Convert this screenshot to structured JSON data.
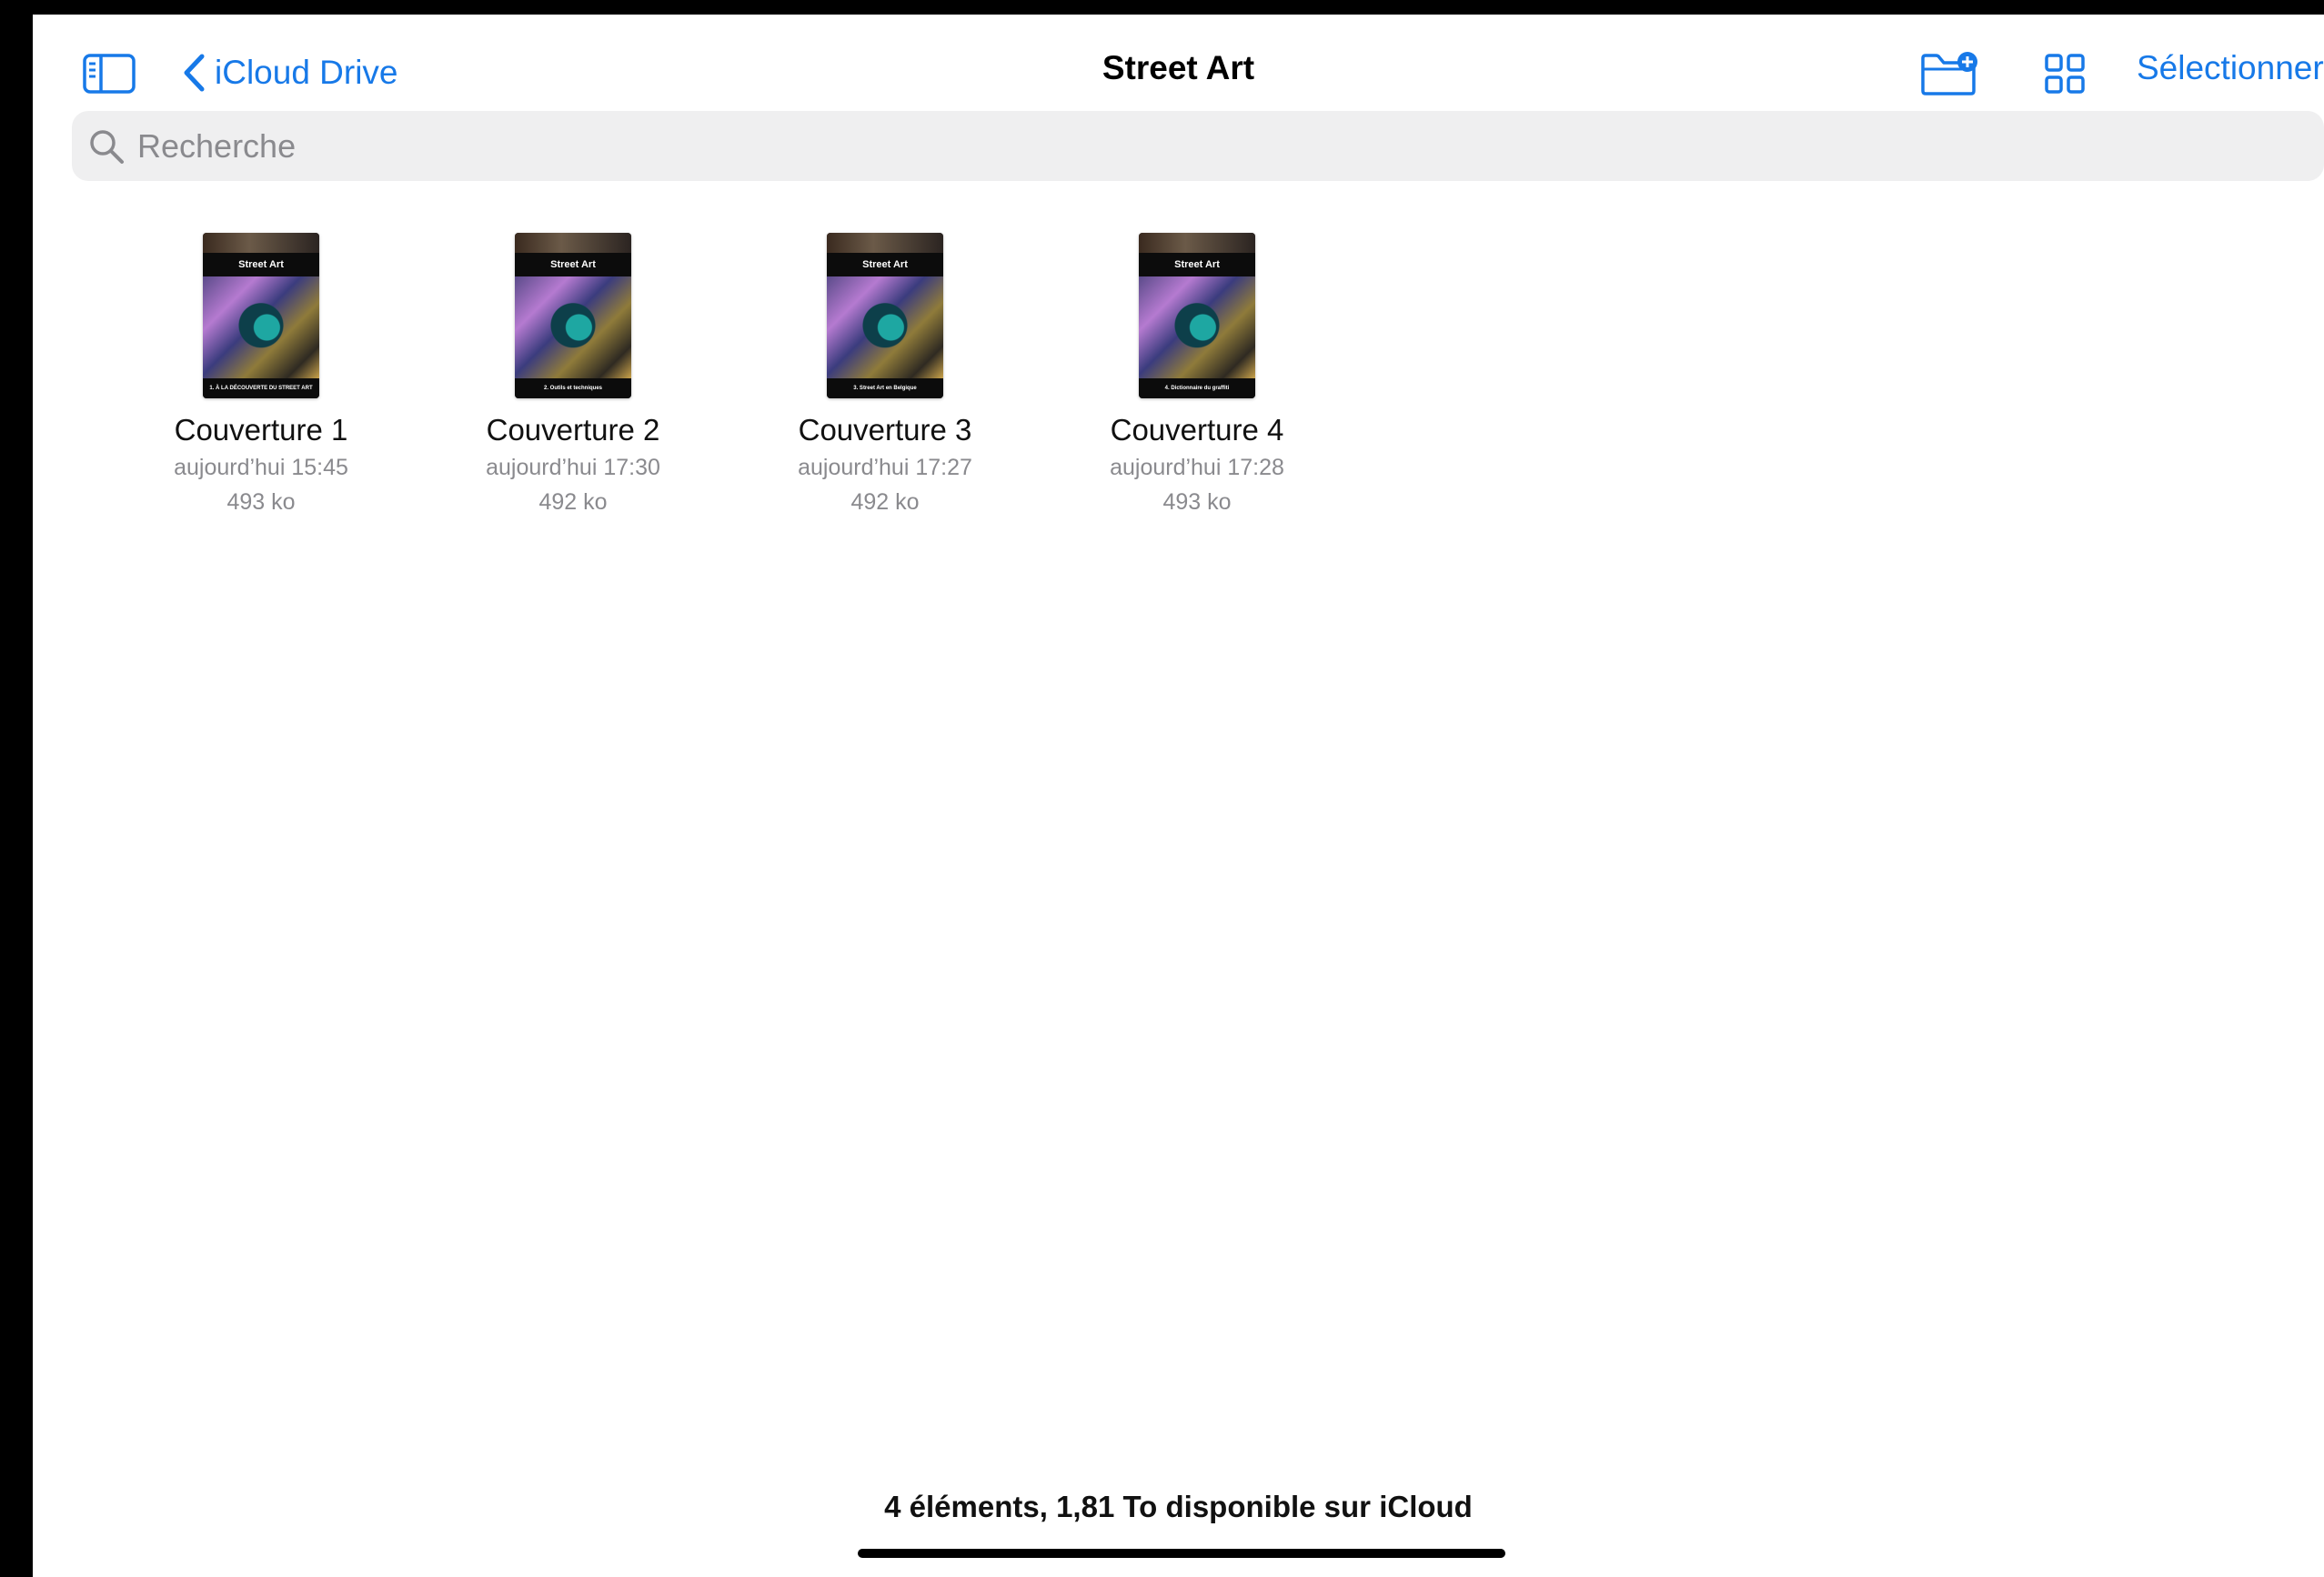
{
  "header": {
    "back_label": "iCloud Drive",
    "title": "Street Art",
    "select_label": "Sélectionner",
    "icons": [
      "sidebar-toggle-icon",
      "chevron-left-icon",
      "folder-add-icon",
      "grid-view-icon"
    ]
  },
  "search": {
    "placeholder": "Recherche",
    "value": ""
  },
  "files": [
    {
      "name": "Couverture 1",
      "date": "aujourd’hui 15:45",
      "size": "493 ko",
      "thumb_title": "Street Art",
      "thumb_subtitle": "1. À LA DÉCOUVERTE DU STREET ART"
    },
    {
      "name": "Couverture 2",
      "date": "aujourd’hui 17:30",
      "size": "492 ko",
      "thumb_title": "Street Art",
      "thumb_subtitle": "2. Outils et techniques"
    },
    {
      "name": "Couverture 3",
      "date": "aujourd’hui 17:27",
      "size": "492 ko",
      "thumb_title": "Street Art",
      "thumb_subtitle": "3. Street Art en Belgique"
    },
    {
      "name": "Couverture 4",
      "date": "aujourd’hui 17:28",
      "size": "493 ko",
      "thumb_title": "Street Art",
      "thumb_subtitle": "4. Dictionnaire du graffiti"
    }
  ],
  "footer": {
    "status": "4 éléments, 1,81 To disponible sur iCloud"
  },
  "colors": {
    "accent": "#1779e8",
    "secondary_text": "#8a8a8e",
    "search_bg": "#efeff0"
  }
}
